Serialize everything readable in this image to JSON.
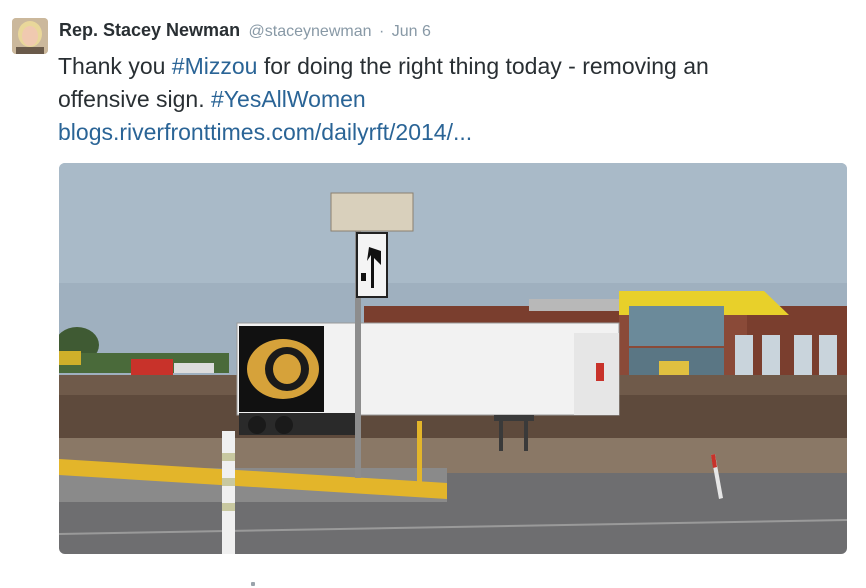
{
  "tweet": {
    "author_name": "Rep. Stacey Newman",
    "handle": "@staceynewman",
    "separator": "·",
    "date": "Jun 6",
    "text_line1_prefix": "Thank you ",
    "hashtag_mizzou": "#Mizzou",
    "text_line1_suffix": " for doing the right thing today - removing an",
    "text_line2_prefix": "offensive sign. ",
    "hashtag_yesallwomen": "#YesAllWomen",
    "link": "blogs.riverfronttimes.com/dailyrft/2014/..."
  },
  "icons": {
    "avatar": "profile-photo",
    "road_sign": "keep-left-arrow-icon",
    "truck_logo": "tiger-head-icon"
  },
  "colors": {
    "name": "#292f33",
    "meta": "#8899a6",
    "link": "#2a6496"
  }
}
